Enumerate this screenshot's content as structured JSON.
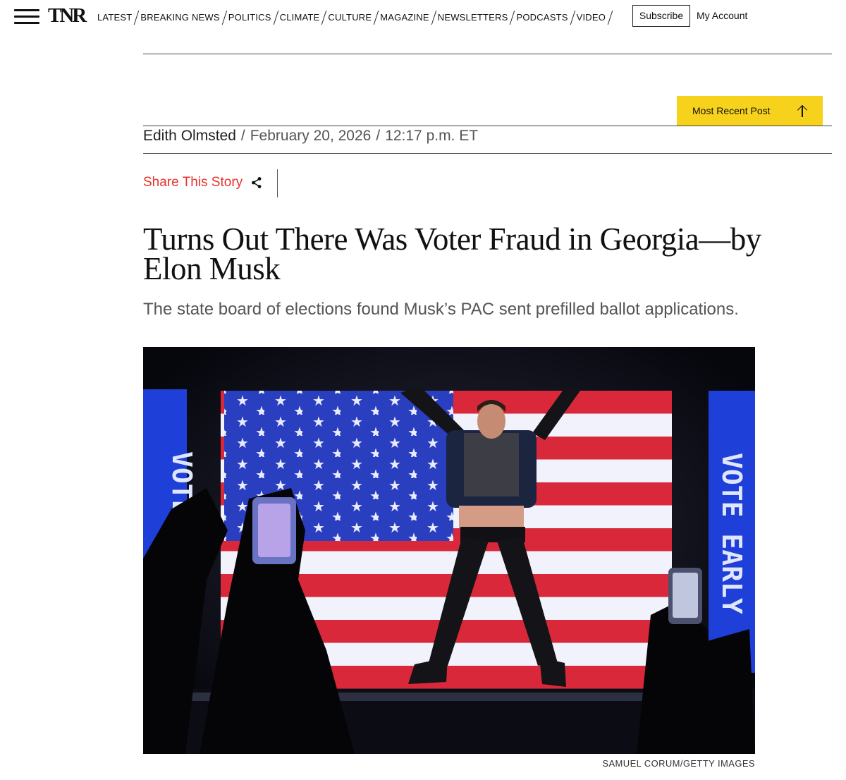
{
  "header": {
    "logo": "TNR",
    "nav_items": [
      "LATEST",
      "BREAKING NEWS",
      "POLITICS",
      "CLIMATE",
      "CULTURE",
      "MAGAZINE",
      "NEWSLETTERS",
      "PODCASTS",
      "VIDEO"
    ],
    "subscribe_label": "Subscribe",
    "account_label": "My Account"
  },
  "most_recent": {
    "label": "Most Recent Post"
  },
  "byline": {
    "author": "Edith Olmsted",
    "date": "February 20, 2026",
    "time": "12:17 p.m. ET"
  },
  "share": {
    "label": "Share This Story"
  },
  "article": {
    "headline": "Turns Out There Was Voter Fraud in Georgia—by Elon Musk",
    "dek": "The state board of elections found Musk’s PAC sent prefilled ballot applications."
  },
  "photo": {
    "banner_left_text": "VOTE EARLY",
    "banner_right_text": "VOTE EARLY",
    "credit": "SAMUEL CORUM/GETTY IMAGES"
  },
  "colors": {
    "accent_red": "#e8322b",
    "button_yellow": "#f7d21c",
    "flag_red": "#d8283a",
    "flag_blue": "#2a3fbf",
    "banner_blue": "#1f3fd9"
  }
}
